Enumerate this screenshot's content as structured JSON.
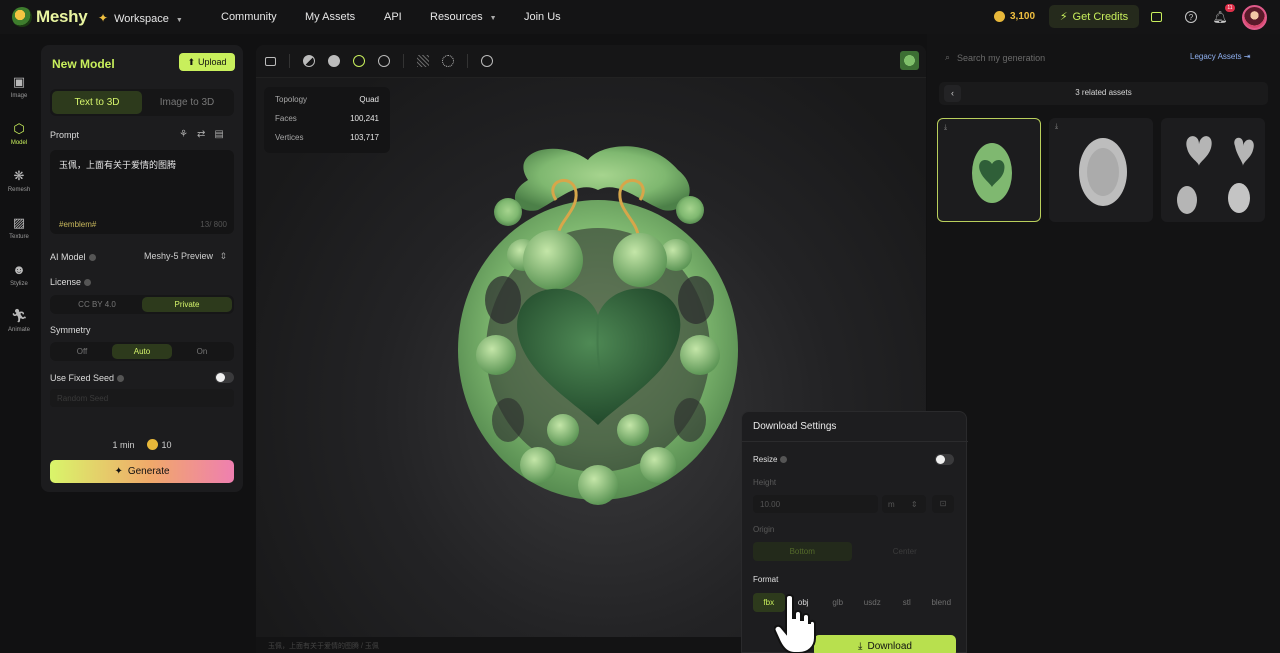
{
  "nav": {
    "brand": "Meshy",
    "workspace": "Workspace",
    "links": [
      "Community",
      "My Assets",
      "API",
      "Resources",
      "Join Us"
    ],
    "credits": "3,100",
    "get_credits": "Get Credits",
    "notification_count": "11"
  },
  "rail": [
    {
      "label": "Image",
      "icon": "image-icon"
    },
    {
      "label": "Model",
      "icon": "cube-icon"
    },
    {
      "label": "Remesh",
      "icon": "remesh-icon"
    },
    {
      "label": "Texture",
      "icon": "texture-icon"
    },
    {
      "label": "Stylize",
      "icon": "stylize-icon"
    },
    {
      "label": "Animate",
      "icon": "running-figure-icon"
    }
  ],
  "panel": {
    "title": "New Model",
    "upload": "Upload",
    "tabs": [
      "Text to 3D",
      "Image to 3D"
    ],
    "prompt_label": "Prompt",
    "prompt_text": "玉佩，上面有关于爱情的图腾",
    "prompt_tag": "#emblem#",
    "prompt_count": "13/ 800",
    "ai_model_label": "AI Model",
    "ai_model_value": "Meshy-5 Preview",
    "license_label": "License",
    "license_options": [
      "CC BY 4.0",
      "Private"
    ],
    "symmetry_label": "Symmetry",
    "symmetry_options": [
      "Off",
      "Auto",
      "On"
    ],
    "seed_label": "Use Fixed Seed",
    "seed_placeholder": "Random Seed",
    "time": "1 min",
    "cost": "10",
    "generate": "Generate"
  },
  "viewport": {
    "stats": [
      {
        "key": "Topology",
        "value": "Quad"
      },
      {
        "key": "Faces",
        "value": "100,241"
      },
      {
        "key": "Vertices",
        "value": "103,717"
      }
    ],
    "subtitle": "玉佩，上面有关于爱情的图腾 / 玉佩"
  },
  "right": {
    "search_placeholder": "Search my generation",
    "legacy": "Legacy Assets",
    "related": "3 related assets"
  },
  "download": {
    "title": "Download Settings",
    "resize_label": "Resize",
    "height_label": "Height",
    "height_value": "10.00",
    "unit": "m",
    "origin_label": "Origin",
    "origin_options": [
      "Bottom",
      "Center"
    ],
    "format_label": "Format",
    "formats": [
      "fbx",
      "obj",
      "glb",
      "usdz",
      "stl",
      "blend"
    ],
    "download_btn": "Download"
  },
  "colors": {
    "accent": "#c8ef5c",
    "jade": "#7fb870",
    "gold": "#d7a64a"
  }
}
